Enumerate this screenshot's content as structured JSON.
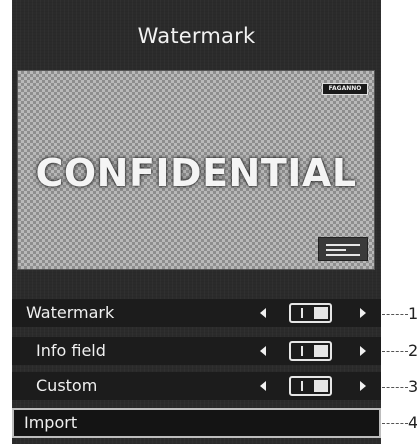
{
  "window": {
    "title": "Watermark"
  },
  "preview": {
    "logo_text": "FAGANNO",
    "watermark_text": "CONFIDENTIAL"
  },
  "rows": [
    {
      "label": "Watermark",
      "toggle_on": true,
      "selected": false
    },
    {
      "label": "Info field",
      "toggle_on": true,
      "selected": false
    },
    {
      "label": "Custom",
      "toggle_on": true,
      "selected": false
    },
    {
      "label": "Import",
      "selected": true
    }
  ],
  "callouts": [
    "1",
    "2",
    "3",
    "4"
  ]
}
